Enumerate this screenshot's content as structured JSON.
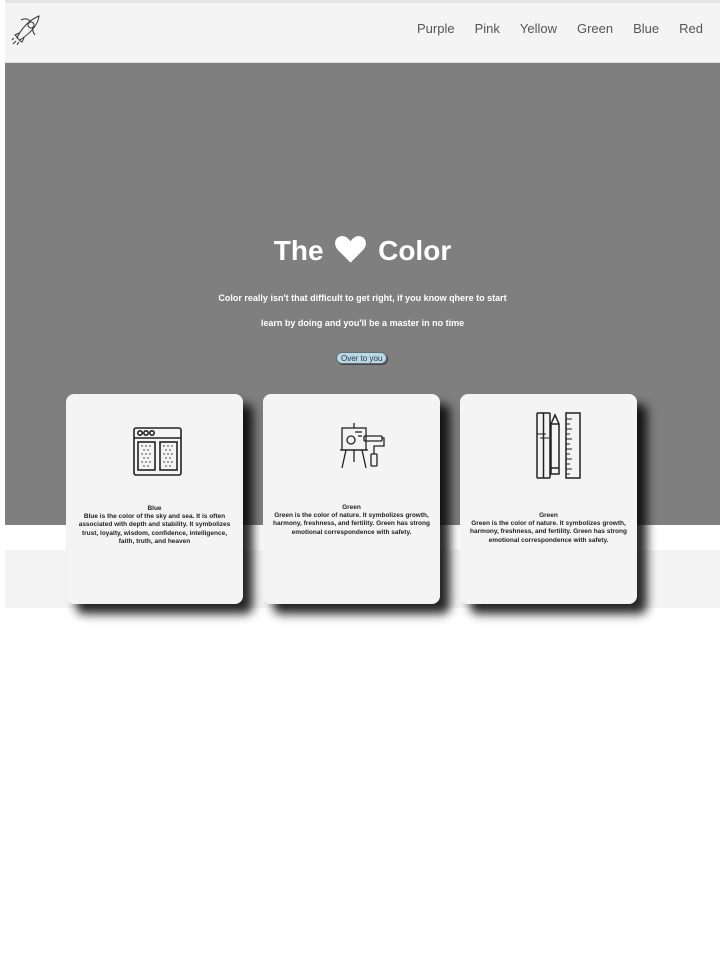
{
  "nav": {
    "links": [
      "Purple",
      "Pink",
      "Yellow",
      "Green",
      "Blue",
      "Red"
    ]
  },
  "hero": {
    "title_left": "The",
    "title_right": "Color",
    "heart_icon": "heart-icon",
    "subtitle1": "Color really isn't that difficult to get right, if you know qhere to start",
    "subtitle2": "learn by doing and you'll be a master in no time",
    "button": "Over to you"
  },
  "cards": [
    {
      "icon": "browser-window-icon",
      "title": "Blue",
      "text": "Blue is the color of the sky and sea. It is often associated with depth and stability. It symbolizes trust, loyalty, wisdom, confidence, intelligence, faith, truth, and heaven"
    },
    {
      "icon": "easel-paint-roller-icon",
      "title": "Green",
      "text": "Green is the color of nature. It symbolizes growth, harmony, freshness, and fertility. Green has strong emotional correspondence with safety."
    },
    {
      "icon": "pen-ruler-icon",
      "title": "Green",
      "text": "Green is the color of nature. It symbolizes growth, harmony, freshness, and fertility. Green has strong emotional correspondence with safety."
    }
  ],
  "colors": {
    "hero_bg": "#7f7f7f",
    "nav_bg": "#f4f4f4",
    "button_bg": "#b6d9ea",
    "card_bg": "#f4f4f4"
  }
}
